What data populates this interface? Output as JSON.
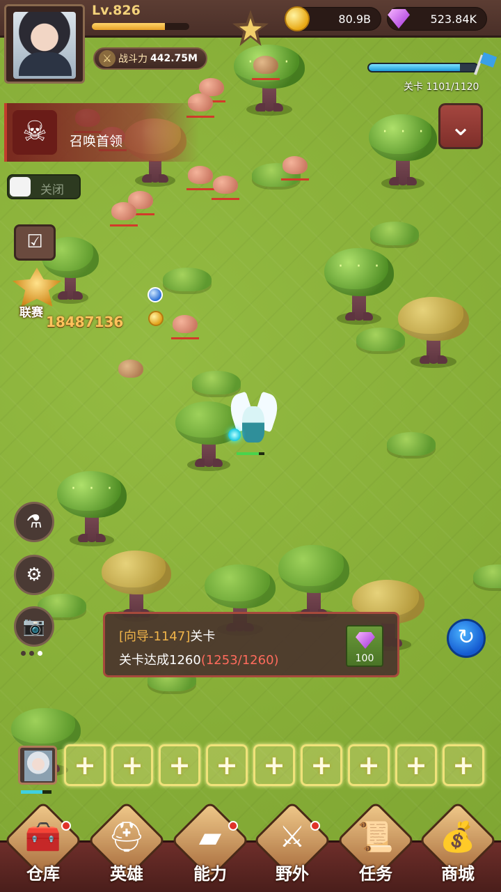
{
  "player": {
    "level": "Lv.826",
    "xp_fraction": 0.75,
    "power_label": "战斗力",
    "power_value": "442.75M"
  },
  "currency": {
    "gold": "80.9B",
    "gems": "523.84K"
  },
  "stage": {
    "label": "关卡 1101/1120",
    "progress_fraction": 0.84
  },
  "boss": {
    "label": "召唤首领"
  },
  "auto_switch": {
    "label": "关闭",
    "on": false
  },
  "league": {
    "label": "联赛",
    "score": "18487136"
  },
  "quest": {
    "tag": "[向导-1147]",
    "title": "关卡",
    "goal": "关卡达成1260",
    "progress": "(1253/1260)",
    "reward_amount": "100"
  },
  "icons": {
    "calendar": "calendar-icon",
    "potion": "potion-icon",
    "settings": "gear-icon",
    "camera": "camera-icon",
    "refresh": "refresh-icon",
    "collapse": "chevron-down-icon"
  },
  "hero_slots": {
    "empty_count": 9,
    "empty_symbol": "+"
  },
  "nav": [
    {
      "label": "仓库",
      "icon": "chest-icon",
      "badge": true
    },
    {
      "label": "英雄",
      "icon": "helmet-icon",
      "badge": false
    },
    {
      "label": "能力",
      "icon": "gold-bars-icon",
      "badge": true
    },
    {
      "label": "野外",
      "icon": "crossed-swords-icon",
      "badge": true
    },
    {
      "label": "任务",
      "icon": "scroll-icon",
      "badge": false
    },
    {
      "label": "商城",
      "icon": "treasure-icon",
      "badge": false
    }
  ],
  "colors": {
    "grass": "#8bb23a",
    "topbar": "#5c3d33",
    "accent_red": "#a64a3c",
    "progress_highlight": "#ff6b5c"
  }
}
